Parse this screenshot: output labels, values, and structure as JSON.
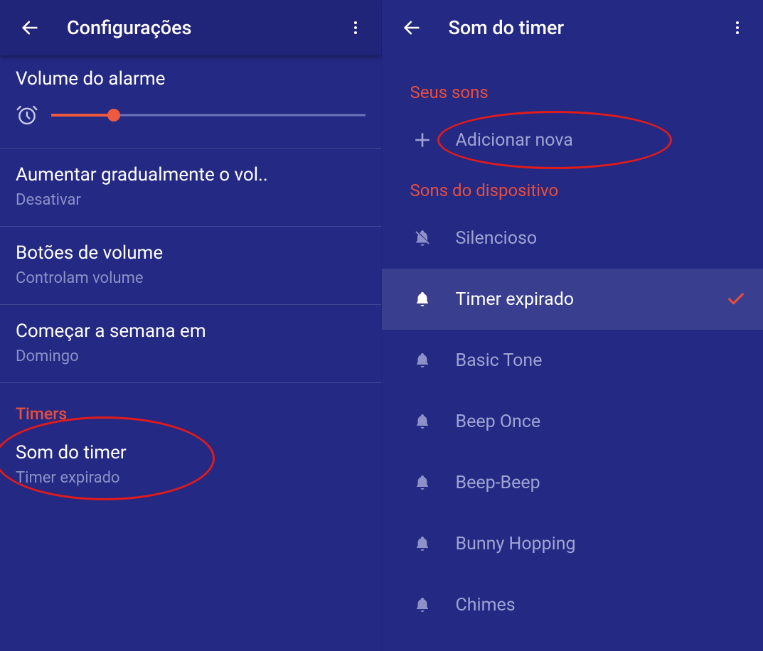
{
  "left": {
    "title": "Configurações",
    "volume_title": "Volume do alarme",
    "slider_percent": 20,
    "settings": [
      {
        "primary": "Aumentar gradualmente o vol..",
        "secondary": "Desativar"
      },
      {
        "primary": "Botões de volume",
        "secondary": "Controlam volume"
      },
      {
        "primary": "Começar a semana em",
        "secondary": "Domingo"
      }
    ],
    "section_timers": "Timers",
    "timer_sound": {
      "primary": "Som do timer",
      "secondary": "Timer expirado"
    }
  },
  "right": {
    "title": "Som do timer",
    "section_your": "Seus sons",
    "add_new": "Adicionar nova",
    "section_device": "Sons do dispositivo",
    "sounds": [
      {
        "label": "Silencioso",
        "muted": true,
        "selected": false
      },
      {
        "label": "Timer expirado",
        "muted": false,
        "selected": true
      },
      {
        "label": "Basic Tone",
        "muted": false,
        "selected": false
      },
      {
        "label": "Beep Once",
        "muted": false,
        "selected": false
      },
      {
        "label": "Beep-Beep",
        "muted": false,
        "selected": false
      },
      {
        "label": "Bunny Hopping",
        "muted": false,
        "selected": false
      },
      {
        "label": "Chimes",
        "muted": false,
        "selected": false
      }
    ]
  }
}
